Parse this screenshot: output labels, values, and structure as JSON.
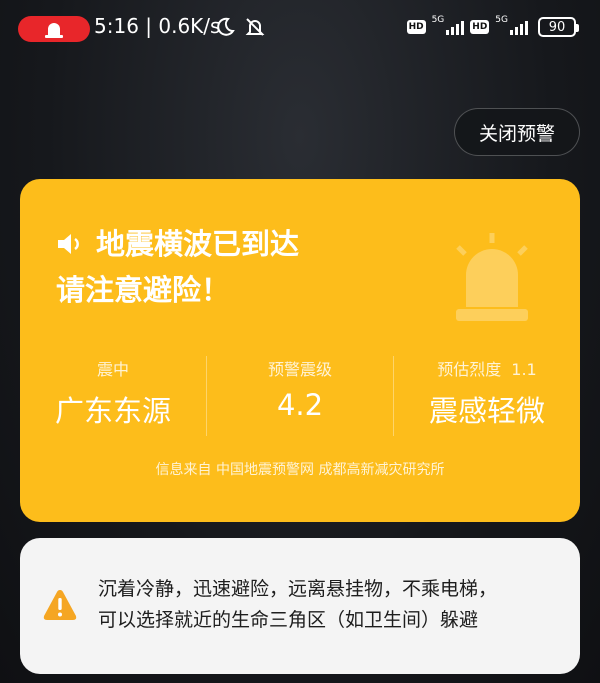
{
  "status_bar": {
    "time_and_speed": "5:16 | 0.6K/s",
    "hd_badge_1": "HD",
    "network_1": "5G",
    "hd_badge_2": "HD",
    "network_2": "5G",
    "battery": "90",
    "icons": [
      "alert-pill-icon",
      "moon-icon",
      "bell-off-icon",
      "signal-icon",
      "battery-icon"
    ]
  },
  "close_button_label": "关闭预警",
  "quake_card": {
    "color": "#fdbd1b",
    "headline_line1": "地震横波已到达",
    "headline_line2": "请注意避险！",
    "epicenter_label": "震中",
    "epicenter_value": "广东东源",
    "magnitude_label": "预警震级",
    "magnitude_value": "4.2",
    "intensity_label": "预估烈度",
    "intensity_number": "1.1",
    "intensity_value": "震感轻微",
    "source": "信息来自 中国地震预警网 成都高新减灾研究所"
  },
  "advice_card": {
    "text_line1": "沉着冷静，迅速避险，远离悬挂物，不乘电梯，",
    "text_line2": "可以选择就近的生命三角区（如卫生间）躲避",
    "icon_color": "#f5a623"
  }
}
